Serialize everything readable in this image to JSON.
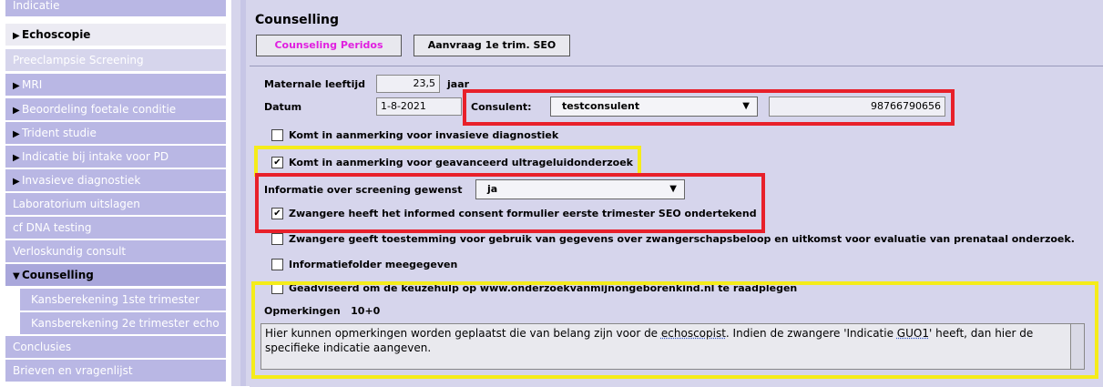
{
  "sidebar": {
    "items": [
      {
        "label": "Indicatie"
      },
      {
        "label": "Echoscopie"
      },
      {
        "label": "Preeclampsie Screening"
      },
      {
        "label": "MRI"
      },
      {
        "label": "Beoordeling foetale conditie"
      },
      {
        "label": "Trident studie"
      },
      {
        "label": "Indicatie bij intake voor PD"
      },
      {
        "label": "Invasieve diagnostiek"
      },
      {
        "label": "Laboratorium uitslagen"
      },
      {
        "label": "cf DNA testing"
      },
      {
        "label": "Verloskundig consult"
      },
      {
        "label": "Counselling"
      },
      {
        "label": "Kansberekening 1ste trimester"
      },
      {
        "label": "Kansberekening 2e trimester echo"
      },
      {
        "label": "Conclusies"
      },
      {
        "label": "Brieven en vragenlijst"
      }
    ]
  },
  "main": {
    "title": "Counselling",
    "buttons": {
      "peridos": "Counseling Peridos",
      "aanvraag": "Aanvraag 1e trim. SEO",
      "peridos_color": "#e020e0"
    },
    "maternale_leeftijd": {
      "label": "Maternale leeftijd",
      "value": "23,5",
      "unit": "jaar"
    },
    "datum": {
      "label": "Datum",
      "value": "1-8-2021"
    },
    "consulent": {
      "label": "Consulent:",
      "value": "testconsulent",
      "number": "98766790656"
    },
    "checkboxes": {
      "invasief": {
        "label": "Komt in aanmerking voor invasieve diagnostiek",
        "checked": false
      },
      "geavanceerd": {
        "label": "Komt in aanmerking voor geavanceerd ultrageluidonderzoek",
        "checked": true
      },
      "informed": {
        "label": "Zwangere heeft het  informed consent formulier eerste trimester SEO ondertekend",
        "checked": true
      },
      "toestemming": {
        "label": "Zwangere geeft toestemming voor gebruik van gegevens over zwangerschapsbeloop en uitkomst voor evaluatie van prenataal onderzoek.",
        "checked": false
      },
      "folder": {
        "label": "Informatiefolder meegegeven",
        "checked": false
      },
      "keuzehulp": {
        "label": "Geadviseerd om de keuzehulp op www.onderzoekvanmijnongeborenkind.nl te raadplegen",
        "checked": false
      }
    },
    "screening": {
      "label": "Informatie over screening gewenst",
      "value": "ja"
    },
    "opmerkingen": {
      "label": "Opmerkingen",
      "term": "10+0",
      "text_1": "Hier kunnen opmerkingen worden geplaatst die van belang zijn voor de ",
      "text_echoscopist": "echoscopist",
      "text_2": ". Indien de zwangere 'Indicatie ",
      "text_guo": "GUO1",
      "text_3": "' heeft, dan hier de",
      "text_line2": "specifieke  indicatie aangeven."
    },
    "highlight_colors": {
      "red": "#e8202a",
      "yellow": "#f5ec1a"
    }
  }
}
